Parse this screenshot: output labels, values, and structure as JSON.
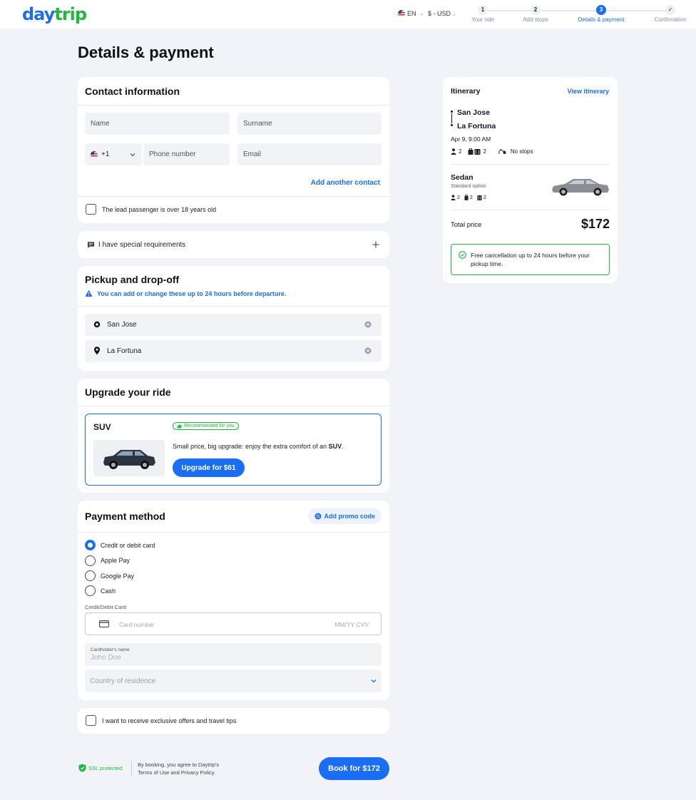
{
  "header": {
    "logo_part1": "day",
    "logo_part2": "trip",
    "language": "EN",
    "currency": "$ - USD",
    "steps": [
      {
        "num": "1",
        "label": "Your ride"
      },
      {
        "num": "2",
        "label": "Add stops"
      },
      {
        "num": "3",
        "label": "Details & payment"
      },
      {
        "num": "✓",
        "label": "Confirmation"
      }
    ],
    "active_step": 3
  },
  "page_title": "Details & payment",
  "contact": {
    "title": "Contact information",
    "name_placeholder": "Name",
    "surname_placeholder": "Surname",
    "phone_code": "+1",
    "phone_placeholder": "Phone number",
    "email_placeholder": "Email",
    "add_contact": "Add another contact",
    "lead_passenger": "The lead passenger is over 18 years old"
  },
  "special": {
    "label": "I have special requirements"
  },
  "pickup": {
    "title": "Pickup and drop-off",
    "notice": "You can add or change these up to 24 hours before departure.",
    "from": "San Jose",
    "to": "La Fortuna"
  },
  "upgrade": {
    "title": "Upgrade your ride",
    "vehicle": "SUV",
    "badge": "Recommended for you",
    "text_before": "Small price, big upgrade: enjoy the extra comfort of an ",
    "text_bold": "SUV",
    "text_after": ".",
    "button": "Upgrade for $61"
  },
  "payment": {
    "title": "Payment method",
    "promo": "Add promo code",
    "options": [
      "Credit or debit card",
      "Apple Pay",
      "Google Pay",
      "Cash"
    ],
    "selected": 0,
    "card_section_label": "Credit/Debit Card",
    "card_placeholder": "Card number",
    "expiry_placeholder": "MM/YY CVV",
    "cardholder_label": "Cardholder's name",
    "cardholder_placeholder": "John Doe",
    "country_placeholder": "Country of residence"
  },
  "offers": {
    "label": "I want to receive exclusive offers and travel tips"
  },
  "footer": {
    "ssl": "SSL protected",
    "terms_line1": "By booking, you agree to Daytrip's",
    "terms_line2": "Terms of Use and Privacy Policy.",
    "book_button": "Book for $172"
  },
  "itinerary": {
    "title": "Itinerary",
    "view_link": "View itinerary",
    "from": "San Jose",
    "to": "La Fortuna",
    "datetime": "Apr 9, 9:00 AM",
    "passengers": "2",
    "luggage": "2",
    "stops": "No stops",
    "vehicle": "Sedan",
    "vehicle_sub": "Standard option",
    "veh_passengers": "2",
    "veh_bags": "2",
    "veh_luggage": "2",
    "total_label": "Total price",
    "total": "$172",
    "cancellation": "Free cancellation up to 24 hours before your pickup time."
  },
  "colors": {
    "brand_blue": "#1a6ef5",
    "brand_green": "#1fb83b",
    "background": "#f1f3f8"
  }
}
